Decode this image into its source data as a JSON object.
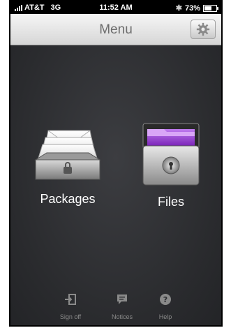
{
  "status_bar": {
    "carrier": "AT&T",
    "network": "3G",
    "time": "11:52 AM",
    "battery": "73%",
    "battery_level": 0.73
  },
  "navbar": {
    "title": "Menu",
    "settings_icon": "gear-icon"
  },
  "tiles": [
    {
      "label": "Packages",
      "icon": "package-tray-icon"
    },
    {
      "label": "Files",
      "icon": "file-cabinet-icon"
    }
  ],
  "tabbar": [
    {
      "label": "Sign off",
      "icon": "sign-off-icon"
    },
    {
      "label": "Notices",
      "icon": "speech-bubble-icon"
    },
    {
      "label": "Help",
      "icon": "help-icon"
    }
  ],
  "colors": {
    "background": "#2c2d30",
    "folder_purple": "#9b3fd6",
    "navbar": "#e8e8e8"
  }
}
